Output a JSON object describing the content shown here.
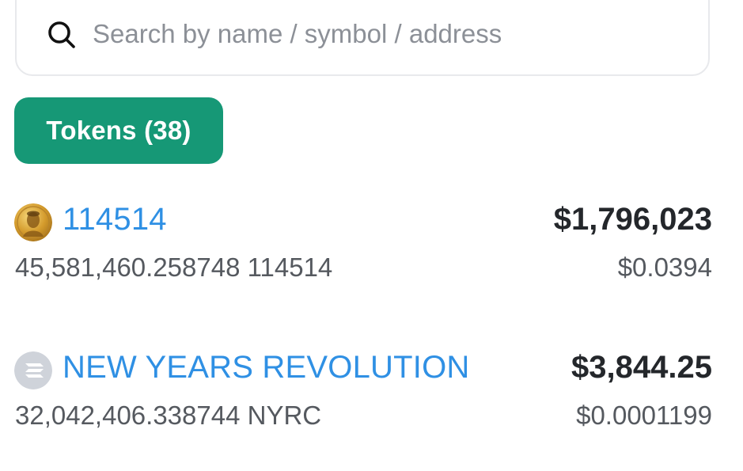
{
  "search": {
    "placeholder": "Search by name / symbol / address",
    "value": "",
    "icon": "search-icon"
  },
  "tabs": [
    {
      "label": "Tokens (38)",
      "active": true
    }
  ],
  "colors": {
    "accent": "#169876",
    "link": "#2f90e4",
    "text": "#24272b",
    "muted": "#55595f"
  },
  "tokens": [
    {
      "name": "114514",
      "value": "$1,796,023",
      "balance": "45,581,460.258748 114514",
      "price": "$0.0394",
      "icon": "coin-portrait-icon"
    },
    {
      "name": "NEW YEARS REVOLUTION",
      "value": "$3,844.25",
      "balance": "32,042,406.338744 NYRC",
      "price": "$0.0001199",
      "icon": "solana-token-icon"
    }
  ]
}
